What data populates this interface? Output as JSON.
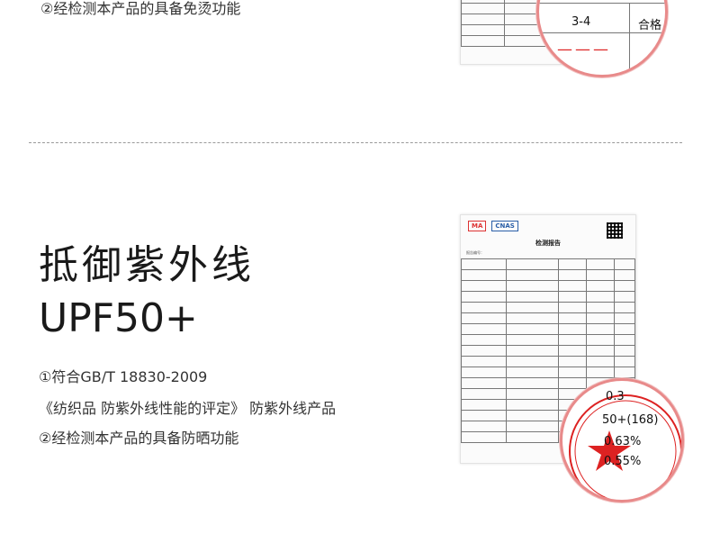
{
  "top_section": {
    "note": "②经检测本产品的具备免烫功能",
    "magnifier": {
      "value": "3-4",
      "result": "合格"
    }
  },
  "section": {
    "heading": "抵御紫外线",
    "subheading": "UPF50+",
    "standard_line": "①符合GB/T 18830-2009",
    "standard_title": "《纺织品 防紫外线性能的评定》 防紫外线产品",
    "note": "②经检测本产品的具备防晒功能"
  },
  "report": {
    "title": "检测报告",
    "logos": [
      "MA",
      "CNAS"
    ],
    "meta": "报告编号：",
    "magnifier": {
      "values": [
        "0.3",
        "50+(168)",
        "0.63%",
        "0.55%"
      ]
    }
  },
  "colors": {
    "stamp": "#dd2222",
    "magnifier_ring": "#e88a8a"
  }
}
